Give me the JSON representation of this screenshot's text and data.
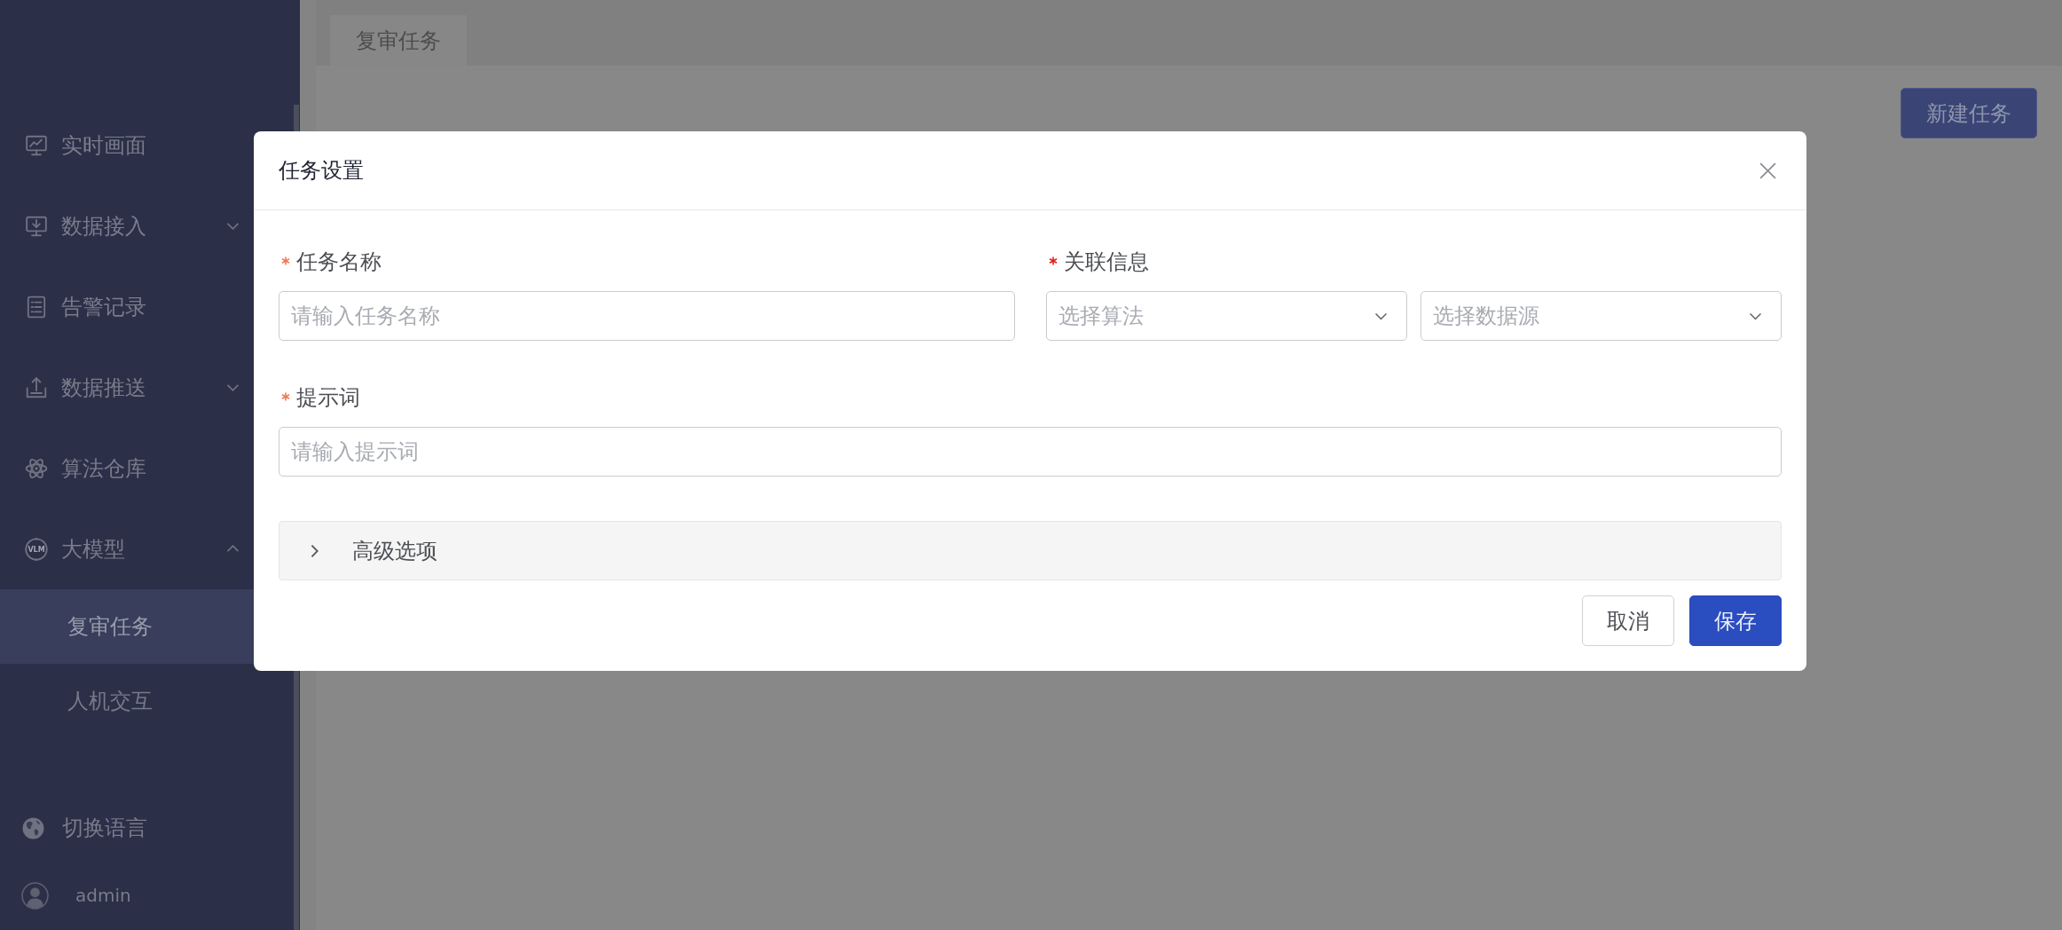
{
  "sidebar": {
    "items": [
      {
        "label": "实时画面",
        "kind": "link",
        "selected": false
      },
      {
        "label": "数据接入",
        "kind": "group",
        "selected": false,
        "expanded": false
      },
      {
        "label": "告警记录",
        "kind": "link",
        "selected": false
      },
      {
        "label": "数据推送",
        "kind": "group",
        "selected": false,
        "expanded": false
      },
      {
        "label": "算法仓库",
        "kind": "link",
        "selected": false
      },
      {
        "label": "大模型",
        "kind": "group",
        "selected": false,
        "expanded": true,
        "icon_text": "VLM",
        "children": [
          {
            "label": "复审任务",
            "selected": true
          },
          {
            "label": "人机交互",
            "selected": false
          }
        ]
      }
    ],
    "footer": [
      {
        "label": "切换语言",
        "kind": "language"
      },
      {
        "label": "admin",
        "kind": "user"
      }
    ]
  },
  "tabs": [
    {
      "label": "复审任务",
      "selected": true
    }
  ],
  "toolbar": {
    "button": "新建任务"
  },
  "dialog": {
    "title": "任务设置",
    "rows": [
      {
        "fields": [
          {
            "kind": "input",
            "label": "任务名称",
            "required": true,
            "color": "#f07a52",
            "placeholder": "请输入任务名称"
          },
          {
            "kind": "selects",
            "label": "关联信息",
            "required": true,
            "color": "#e0201e",
            "selects": [
              {
                "placeholder": "选择算法"
              },
              {
                "placeholder": "选择数据源"
              }
            ]
          }
        ]
      },
      {
        "fields": [
          {
            "kind": "input",
            "label": "提示词",
            "required": true,
            "color": "#f07a52",
            "placeholder": "请输入提示词"
          }
        ]
      }
    ],
    "advanced": {
      "label": "高级选项",
      "expanded": false
    },
    "buttons": [
      {
        "label": "取消",
        "kind": "plain"
      },
      {
        "label": "保存",
        "kind": "primary"
      }
    ]
  }
}
